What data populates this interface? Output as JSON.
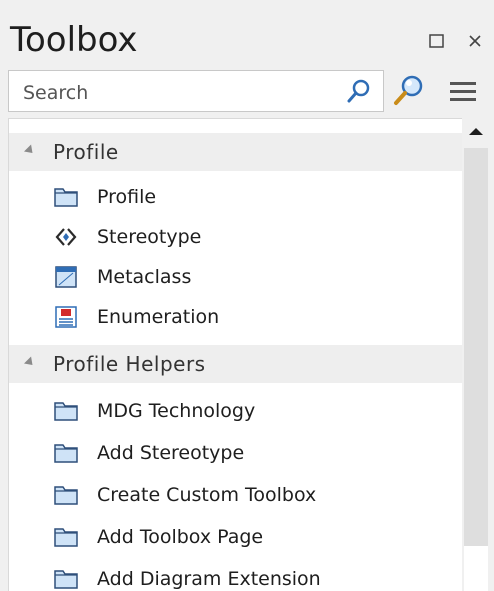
{
  "window": {
    "title": "Toolbox",
    "restore_icon": "restore-icon",
    "close_icon": "close-icon"
  },
  "search": {
    "placeholder": "Search",
    "value": ""
  },
  "groups": [
    {
      "label": "Profile",
      "items": [
        {
          "label": "Profile",
          "icon": "package-icon"
        },
        {
          "label": "Stereotype",
          "icon": "stereotype-icon"
        },
        {
          "label": "Metaclass",
          "icon": "metaclass-icon"
        },
        {
          "label": "Enumeration",
          "icon": "enumeration-icon"
        }
      ]
    },
    {
      "label": "Profile Helpers",
      "items": [
        {
          "label": "MDG Technology",
          "icon": "package-icon"
        },
        {
          "label": "Add Stereotype",
          "icon": "package-icon"
        },
        {
          "label": "Create Custom Toolbox",
          "icon": "package-icon"
        },
        {
          "label": "Add Toolbox Page",
          "icon": "package-icon"
        },
        {
          "label": "Add Diagram Extension",
          "icon": "package-icon"
        }
      ]
    }
  ],
  "colors": {
    "panel_bg": "#f0f0f0",
    "group_header_bg": "#eeeeee",
    "icon_blue": "#2f6db5",
    "icon_fill": "#cfe3f7",
    "enum_red": "#d22a2a"
  }
}
